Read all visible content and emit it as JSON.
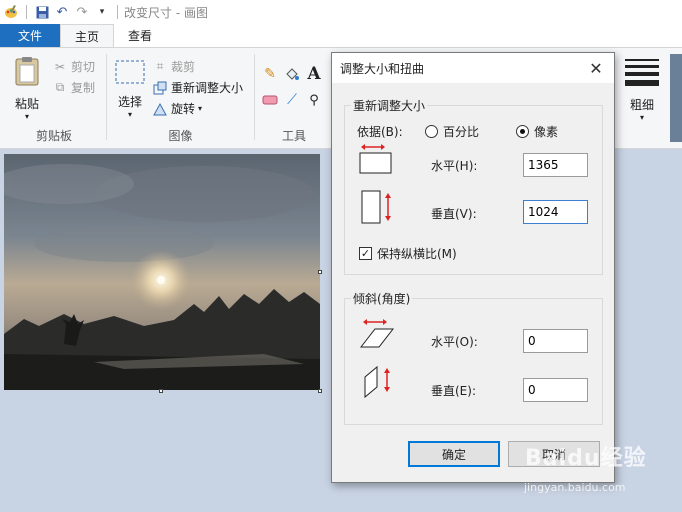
{
  "window": {
    "title": "改变尺寸 - 画图"
  },
  "tabs": {
    "file": "文件",
    "home": "主页",
    "view": "查看"
  },
  "ribbon": {
    "clipboard": {
      "paste": "粘贴",
      "cut": "剪切",
      "copy": "复制",
      "label": "剪贴板"
    },
    "image": {
      "select": "选择",
      "crop": "裁剪",
      "resize": "重新调整大小",
      "rotate": "旋转",
      "label": "图像"
    },
    "tools": {
      "label": "工具"
    },
    "size": {
      "label": "粗细"
    }
  },
  "dialog": {
    "title": "调整大小和扭曲",
    "resize": {
      "legend": "重新调整大小",
      "by_label": "依据(B):",
      "percent": "百分比",
      "pixels": "像素",
      "horizontal_label": "水平(H):",
      "horizontal_value": "1365",
      "vertical_label": "垂直(V):",
      "vertical_value": "1024",
      "keep_ratio": "保持纵横比(M)"
    },
    "skew": {
      "legend": "倾斜(角度)",
      "horizontal_label": "水平(O):",
      "horizontal_value": "0",
      "vertical_label": "垂直(E):",
      "vertical_value": "0"
    },
    "ok": "确定",
    "cancel": "取消"
  },
  "watermark": {
    "brand": "Baidu经验",
    "url": "jingyan.baidu.com"
  },
  "colors": {
    "accent": "#1e6fbf",
    "focus": "#0078d7",
    "canvas_bg": "#c8d3e3"
  }
}
